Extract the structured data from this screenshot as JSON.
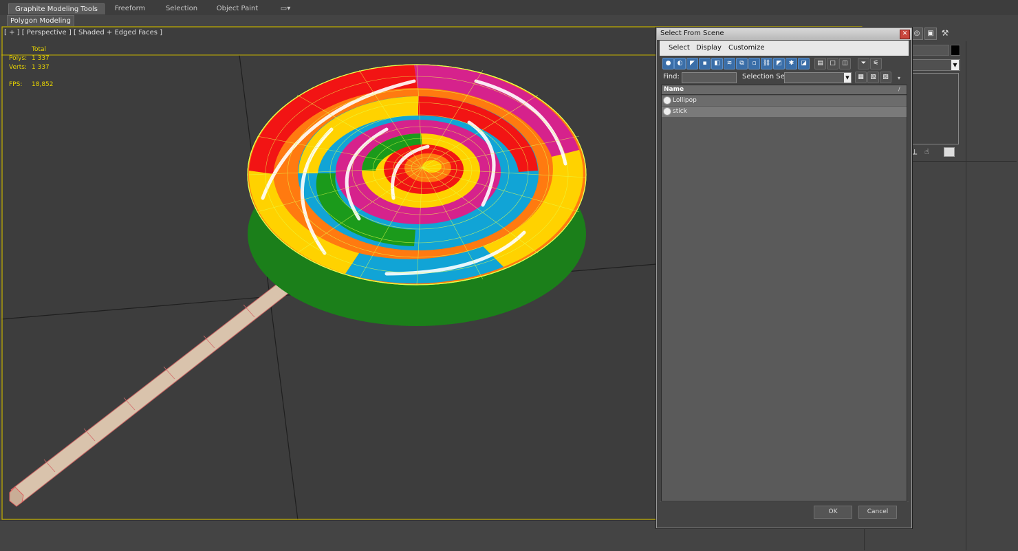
{
  "ribbon": {
    "tabs": [
      "Graphite Modeling Tools",
      "Freeform",
      "Selection",
      "Object Paint"
    ],
    "active_tab": "Graphite Modeling Tools",
    "panel_button": "Polygon Modeling"
  },
  "viewport": {
    "label": "[ + ] [ Perspective ] [ Shaded + Edged Faces ]",
    "stats": {
      "total_label": "Total",
      "polys_label": "Polys:",
      "polys_value": "1 337",
      "verts_label": "Verts:",
      "verts_value": "1 337",
      "fps_label": "FPS:",
      "fps_value": "18,852"
    }
  },
  "dialog": {
    "title": "Select From Scene",
    "menu": [
      "Select",
      "Display",
      "Customize"
    ],
    "find_label": "Find:",
    "selection_set_label": "Selection Set:",
    "list_header": "Name",
    "items": [
      "Lollipop",
      "stick"
    ],
    "ok_label": "OK",
    "cancel_label": "Cancel"
  },
  "colors": {
    "accent": "#3a6ea8",
    "stats_yellow": "#e8d400",
    "viewport_border": "#c8b400",
    "wireframe": "#e6ff4a"
  }
}
